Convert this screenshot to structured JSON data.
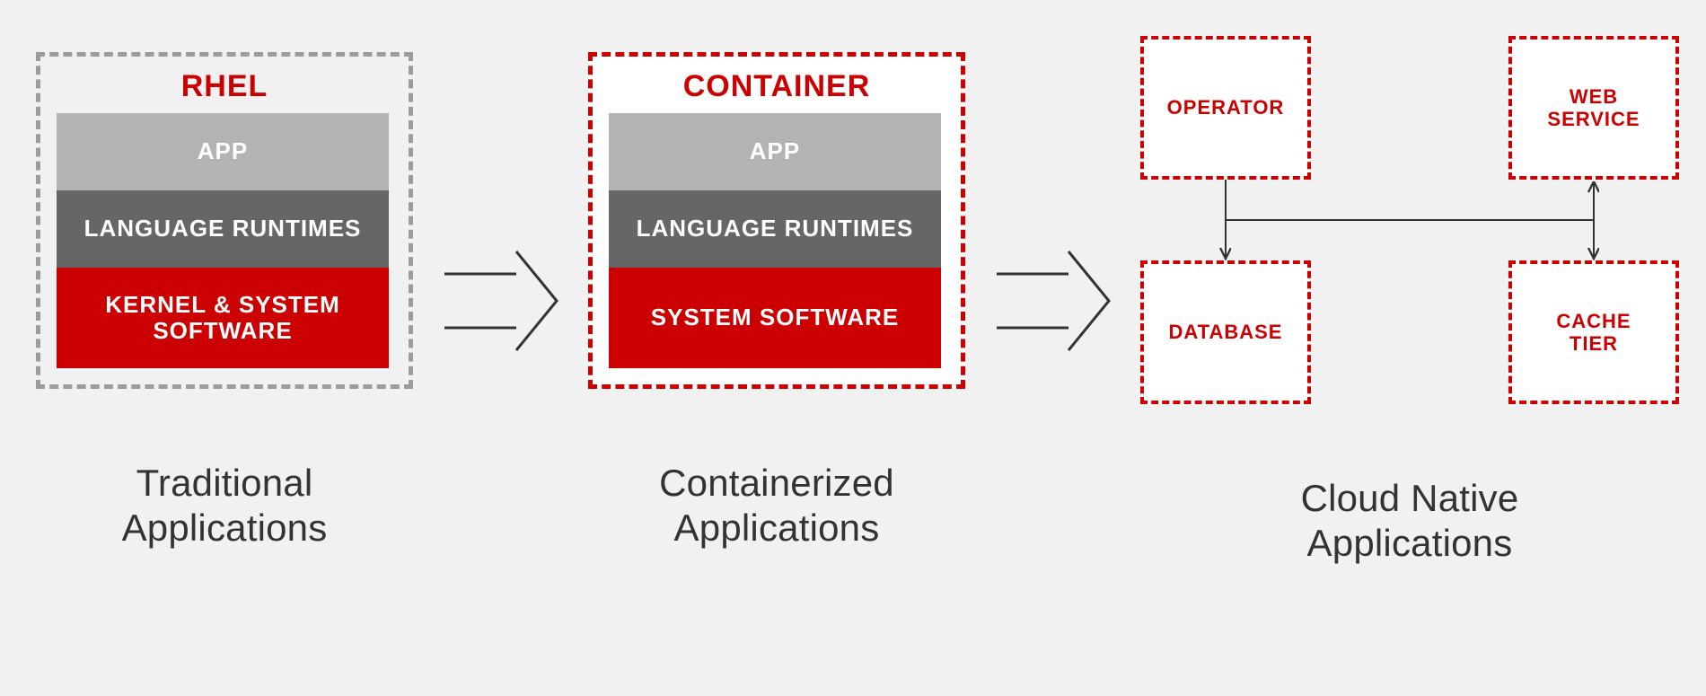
{
  "colors": {
    "red": "#cc0000",
    "gray_light": "#b3b3b3",
    "gray_dark": "#666666",
    "dash_gray": "#9c9c9c"
  },
  "panel1": {
    "title": "RHEL",
    "layers": [
      "APP",
      "LANGUAGE RUNTIMES",
      "KERNEL & SYSTEM SOFTWARE"
    ],
    "caption": "Traditional\nApplications"
  },
  "panel2": {
    "title": "CONTAINER",
    "layers": [
      "APP",
      "LANGUAGE RUNTIMES",
      "SYSTEM SOFTWARE"
    ],
    "caption": "Containerized\nApplications"
  },
  "panel3": {
    "boxes": {
      "tl": "OPERATOR",
      "tr": "WEB\nSERVICE",
      "bl": "DATABASE",
      "br": "CACHE\nTIER"
    },
    "caption": "Cloud Native\nApplications",
    "connections": [
      {
        "from": "tl",
        "to": "bl",
        "arrows": "end"
      },
      {
        "from": "tr",
        "to": "br",
        "arrows": "both"
      },
      {
        "from": "tl-bl-mid",
        "to": "tr-br-mid",
        "arrows": "none"
      }
    ]
  }
}
